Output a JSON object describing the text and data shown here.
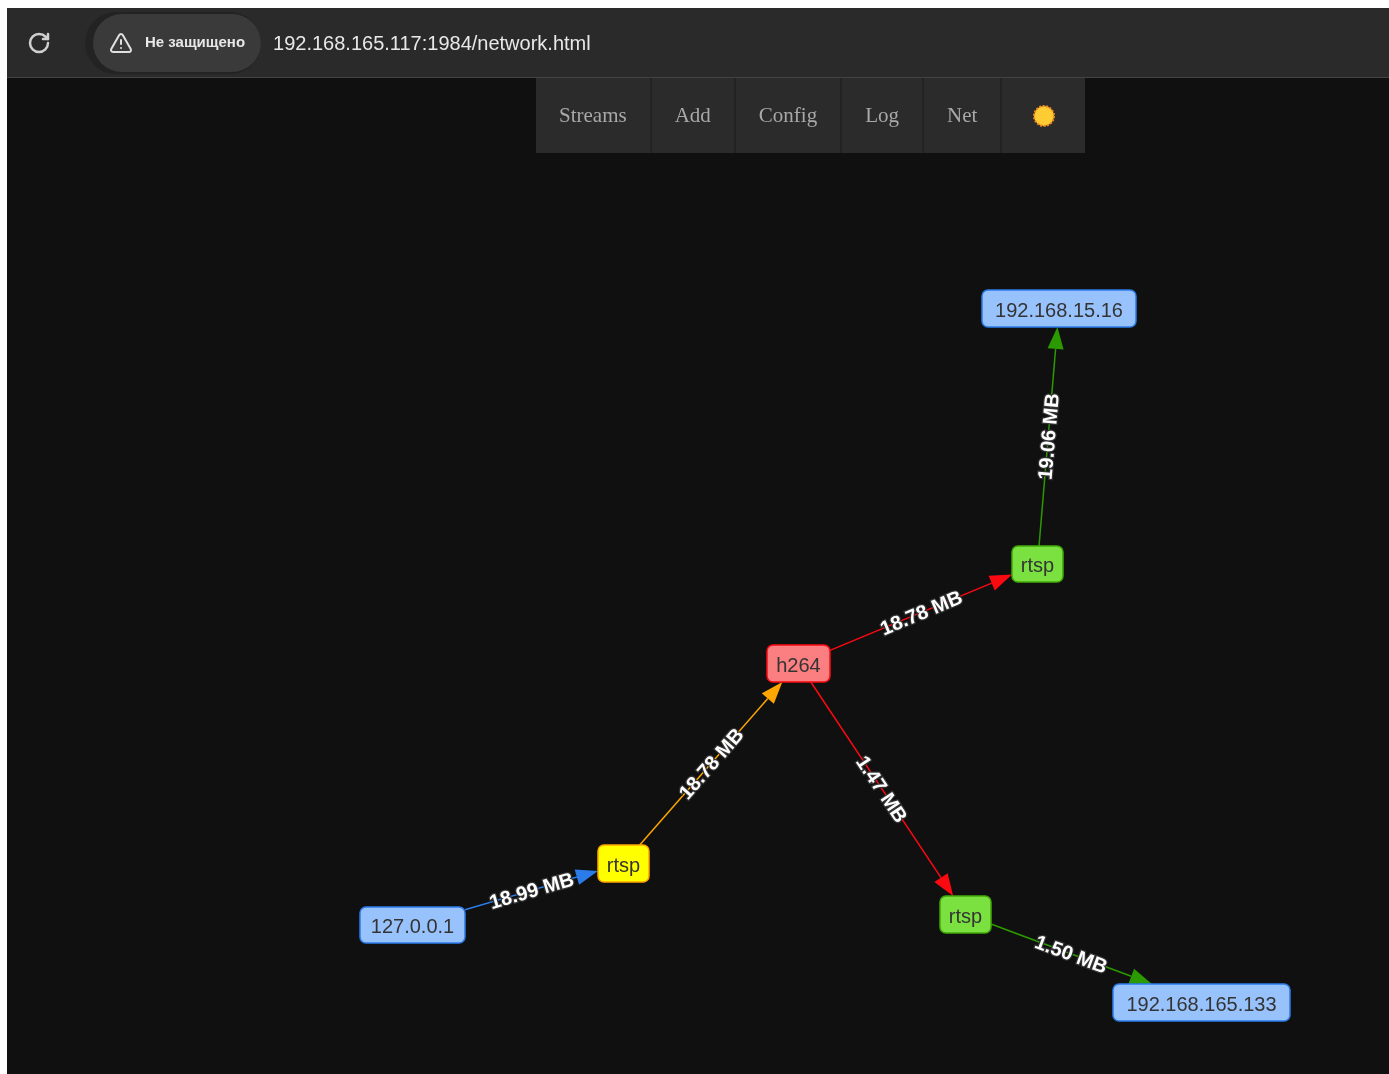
{
  "browser": {
    "security_label": "Не защищено",
    "url": "192.168.165.117:1984/network.html"
  },
  "nav": {
    "items": [
      {
        "label": "Streams"
      },
      {
        "label": "Add"
      },
      {
        "label": "Config"
      },
      {
        "label": "Log"
      },
      {
        "label": "Net"
      }
    ]
  },
  "graph": {
    "nodes": [
      {
        "label": "192.168.15.16",
        "color": "#97c2fc"
      },
      {
        "label": "rtsp",
        "color": "#7be141"
      },
      {
        "label": "h264",
        "color": "#fb7e81"
      },
      {
        "label": "rtsp",
        "color": "#ffff00"
      },
      {
        "label": "127.0.0.1",
        "color": "#97c2fc"
      },
      {
        "label": "rtsp",
        "color": "#7be141"
      },
      {
        "label": "192.168.165.133",
        "color": "#97c2fc"
      }
    ],
    "edges": [
      {
        "label": "18.99 MB",
        "color": "#2b7ce9"
      },
      {
        "label": "18.78 MB",
        "color": "#ffa500"
      },
      {
        "label": "18.78 MB",
        "color": "#fa0a10"
      },
      {
        "label": "19.06 MB",
        "color": "#2b9a00"
      },
      {
        "label": "1.47 MB",
        "color": "#fa0a10"
      },
      {
        "label": "1.50 MB",
        "color": "#2b9a00"
      }
    ]
  }
}
